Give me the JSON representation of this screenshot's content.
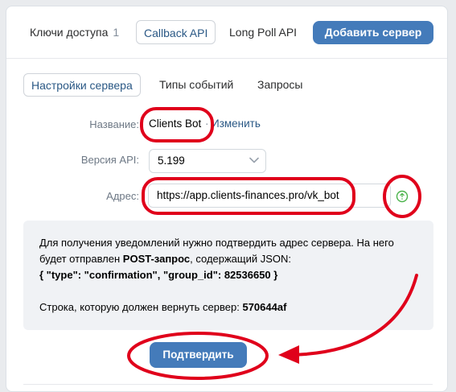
{
  "tabs": {
    "keys_label": "Ключи доступа",
    "keys_count": "1",
    "callback_label": "Callback API",
    "longpoll_label": "Long Poll API"
  },
  "add_server_label": "Добавить сервер",
  "subtabs": {
    "settings": "Настройки сервера",
    "events": "Типы событий",
    "requests": "Запросы"
  },
  "form": {
    "name_label": "Название:",
    "name_value": "Clients Bot",
    "name_separator": "·",
    "change_link": "Изменить",
    "api_label": "Версия API:",
    "api_value": "5.199",
    "address_label": "Адрес:",
    "address_value": "https://app.clients-finances.pro/vk_bot"
  },
  "info": {
    "line1": "Для получения уведомлений нужно подтвердить адрес сервера. На него",
    "line2_prefix": "будет отправлен ",
    "line2_bold": "POST-запрос",
    "line2_suffix": ", содержащий JSON:",
    "json_text": "{ \"type\": \"confirmation\", \"group_id\": 82536650 }",
    "return_prefix": "Строка, которую должен вернуть сервер: ",
    "return_code": "570644af"
  },
  "confirm_label": "Подтвердить",
  "colors": {
    "accent": "#447bba",
    "link": "#2a5885",
    "annotation": "#e0001b",
    "status_ok": "#4bb34b"
  },
  "icons": {
    "api_select": "chevron-down-icon",
    "address_status": "status-ok-icon"
  }
}
